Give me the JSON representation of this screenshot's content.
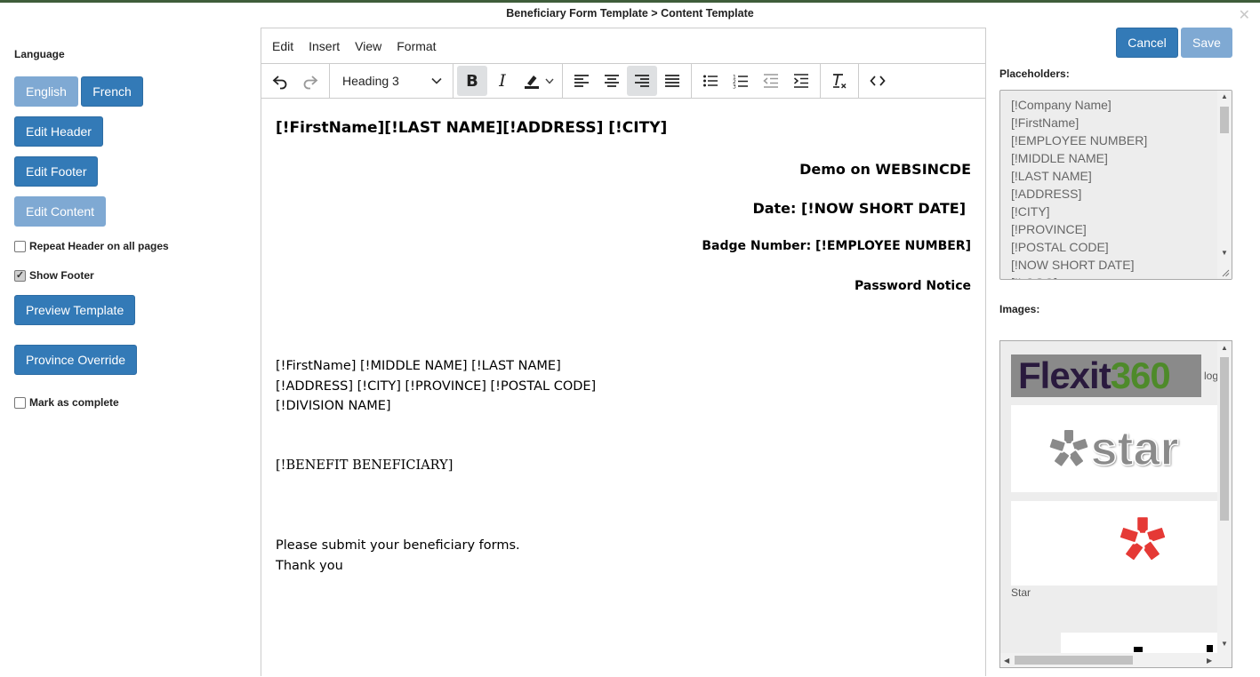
{
  "dialog": {
    "title": "Beneficiary Form Template > Content Template",
    "close_icon": "close-icon"
  },
  "left": {
    "language_label": "Language",
    "english_label": "English",
    "french_label": "French",
    "edit_header_label": "Edit Header",
    "edit_footer_label": "Edit Footer",
    "edit_content_label": "Edit Content",
    "repeat_header_label": "Repeat Header on all pages",
    "repeat_header_checked": false,
    "show_footer_label": "Show Footer",
    "show_footer_checked": true,
    "preview_label": "Preview Template",
    "province_override_label": "Province Override",
    "mark_complete_label": "Mark as complete",
    "mark_complete_checked": false
  },
  "editor": {
    "menu": [
      "Edit",
      "Insert",
      "View",
      "Format"
    ],
    "block_format": "Heading 3",
    "content": {
      "line1": "[!FirstName][!LAST NAME][!ADDRESS] [!CITY]",
      "demo": "Demo on WEBSINCDE",
      "date": "Date: [!NOW SHORT DATE]",
      "badge": "Badge Number: [!EMPLOYEE NUMBER]",
      "notice": "Password Notice",
      "addr1": "[!FirstName] [!MIDDLE NAME] [!LAST NAME]",
      "addr2": "[!ADDRESS] [!CITY] [!PROVINCE] [!POSTAL CODE]",
      "addr3": "[!DIVISION NAME]",
      "benefit": "[!BENEFIT BENEFICIARY]",
      "submit": "Please submit your beneficiary forms.",
      "thanks": "Thank you"
    }
  },
  "actions": {
    "cancel_label": "Cancel",
    "save_label": "Save"
  },
  "placeholders": {
    "label": "Placeholders:",
    "items": [
      "[!Company Name]",
      "[!FirstName]",
      "[!EMPLOYEE NUMBER]",
      "[!MIDDLE NAME]",
      "[!LAST NAME]",
      "[!ADDRESS]",
      "[!CITY]",
      "[!PROVINCE]",
      "[!POSTAL CODE]",
      "[!NOW SHORT DATE]",
      "[!LOGO]"
    ]
  },
  "images": {
    "label": "Images:",
    "flexit_text": "Flexit",
    "flexit_num": "360",
    "flexit_caption": "log",
    "star_word": "star",
    "star_caption": "Star"
  },
  "colors": {
    "primary": "#337ab7",
    "primary_light": "#7fa9d3",
    "flexit_purple": "#2a1a3e",
    "flexit_green": "#4e8a2a",
    "star_red": "#e53935"
  }
}
